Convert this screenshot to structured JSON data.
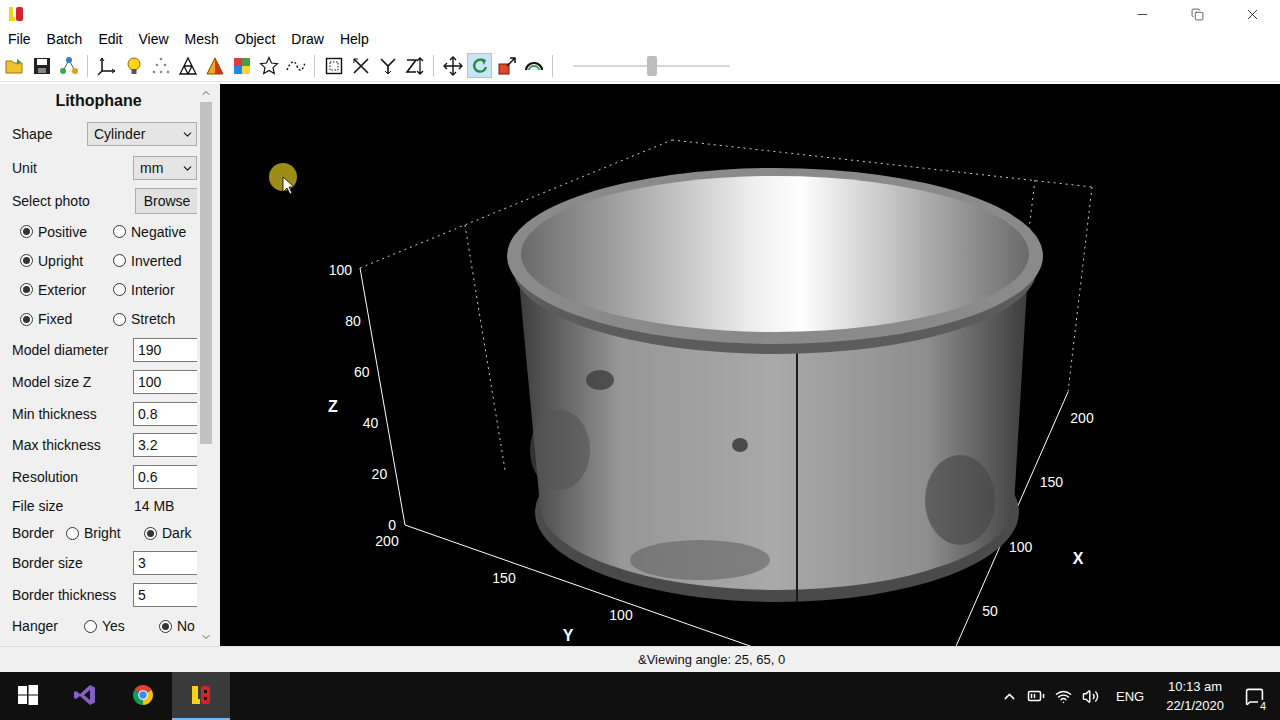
{
  "titlebar": {
    "controls": [
      {
        "kind": "minimize"
      },
      {
        "kind": "restore"
      },
      {
        "kind": "close"
      }
    ]
  },
  "menu": [
    "File",
    "Batch",
    "Edit",
    "View",
    "Mesh",
    "Object",
    "Draw",
    "Help"
  ],
  "toolbar": {
    "groups": [
      [
        {
          "kind": "open",
          "selected": false
        },
        {
          "kind": "save",
          "selected": false
        },
        {
          "kind": "tree",
          "selected": false
        }
      ],
      [
        {
          "kind": "axes",
          "selected": false
        },
        {
          "kind": "light",
          "selected": false
        },
        {
          "kind": "points",
          "selected": false
        },
        {
          "kind": "wireframe",
          "selected": false
        },
        {
          "kind": "shaded",
          "selected": false
        },
        {
          "kind": "colormap",
          "selected": false
        },
        {
          "kind": "star",
          "selected": false
        },
        {
          "kind": "curve",
          "selected": false
        }
      ],
      [
        {
          "kind": "box",
          "selected": false
        },
        {
          "kind": "xaxis",
          "selected": false
        },
        {
          "kind": "yaxis",
          "selected": false
        },
        {
          "kind": "zaxis",
          "selected": false
        }
      ],
      [
        {
          "kind": "move",
          "selected": false
        },
        {
          "kind": "rotate",
          "selected": true
        },
        {
          "kind": "scale",
          "selected": false
        },
        {
          "kind": "rainbow",
          "selected": false
        }
      ]
    ],
    "slider": {
      "level": 0.5
    }
  },
  "panel": {
    "title": "Lithophane",
    "scrollbar": {
      "level": 0.65
    },
    "rows": [
      {
        "kind": "select",
        "label": "Shape",
        "value": "Cylinder"
      },
      {
        "kind": "select",
        "label": "Unit",
        "value": "mm"
      },
      {
        "kind": "button",
        "label": "Select photo",
        "value": "Browse"
      },
      {
        "kind": "radios",
        "options": [
          {
            "label": "Positive",
            "selected": true
          },
          {
            "label": "Negative",
            "selected": false
          }
        ]
      },
      {
        "kind": "radios",
        "options": [
          {
            "label": "Upright",
            "selected": true
          },
          {
            "label": "Inverted",
            "selected": false
          }
        ]
      },
      {
        "kind": "radios",
        "options": [
          {
            "label": "Exterior",
            "selected": true
          },
          {
            "label": "Interior",
            "selected": false
          }
        ]
      },
      {
        "kind": "radios",
        "options": [
          {
            "label": "Fixed",
            "selected": true
          },
          {
            "label": "Stretch",
            "selected": false
          }
        ]
      },
      {
        "kind": "input",
        "label": "Model diameter",
        "value": "190"
      },
      {
        "kind": "input",
        "label": "Model size Z",
        "value": "100"
      },
      {
        "kind": "input",
        "label": "Min thickness",
        "value": "0.8"
      },
      {
        "kind": "input",
        "label": "Max thickness",
        "value": "3.2"
      },
      {
        "kind": "input",
        "label": "Resolution",
        "value": "0.6"
      },
      {
        "kind": "text",
        "label": "File size",
        "value": "14 MB"
      },
      {
        "kind": "radios",
        "label": "Border",
        "options": [
          {
            "label": "Bright",
            "selected": false
          },
          {
            "label": "Dark",
            "selected": true
          }
        ]
      },
      {
        "kind": "input",
        "label": "Border size",
        "value": "3"
      },
      {
        "kind": "input",
        "label": "Border thickness",
        "value": "5"
      },
      {
        "kind": "radios",
        "label": "Hanger",
        "options": [
          {
            "label": "Yes",
            "selected": false
          },
          {
            "label": "No",
            "selected": true
          }
        ]
      }
    ]
  },
  "viewport": {
    "axes": {
      "z": {
        "label": "Z",
        "ticks": [
          "100",
          "80",
          "60",
          "40",
          "20",
          "0"
        ]
      },
      "y": {
        "label": "Y",
        "ticks": [
          "200",
          "150",
          "100"
        ]
      },
      "x": {
        "label": "X",
        "ticks": [
          "200",
          "150",
          "100",
          "50"
        ]
      }
    }
  },
  "status_bar": {
    "text": "&Viewing angle: 25, 65, 0"
  },
  "taskbar": {
    "apps": [
      {
        "kind": "start",
        "selected": false
      },
      {
        "kind": "visual-studio",
        "selected": false
      },
      {
        "kind": "chrome",
        "selected": false
      },
      {
        "kind": "lithophane",
        "selected": true
      }
    ],
    "language": "ENG",
    "time": "10:13 am",
    "date": "22/1/2020",
    "notifications": "4"
  }
}
